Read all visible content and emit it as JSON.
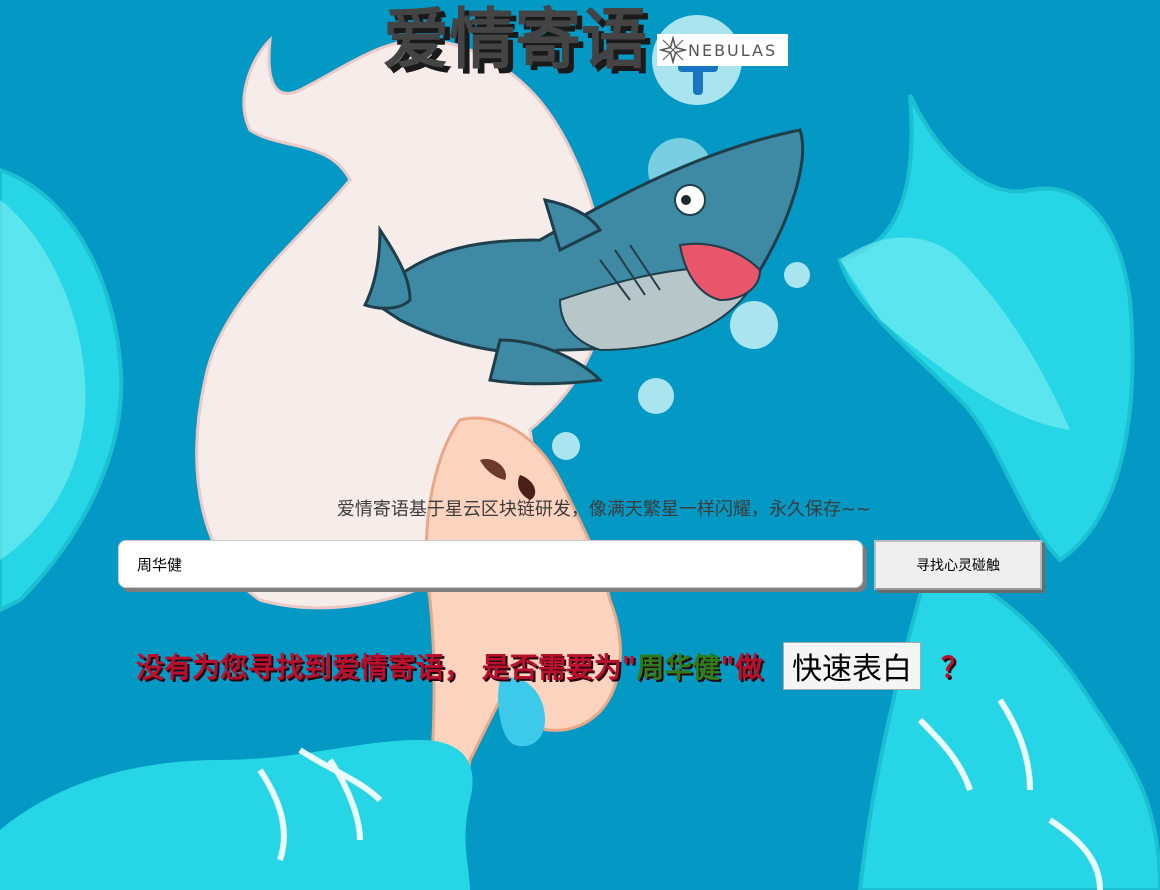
{
  "header": {
    "title": "爱情寄语",
    "logo_text": "NEBULAS"
  },
  "subtitle": "爱情寄语基于星云区块链研发，像满天繁星一样闪耀，永久保存~~",
  "search": {
    "value": "周华健",
    "button_label": "寻找心灵碰触"
  },
  "notice": {
    "prefix": "没有为您寻找到爱情寄语，  是否需要为 ",
    "open_quote": "\"",
    "name": "周华健",
    "close_quote": "\"",
    "verb": " 做",
    "quick_button": "快速表白",
    "suffix": "？"
  },
  "colors": {
    "background": "#0499c4",
    "notice_text": "#b8102d",
    "notice_name": "#2e7d1a"
  }
}
